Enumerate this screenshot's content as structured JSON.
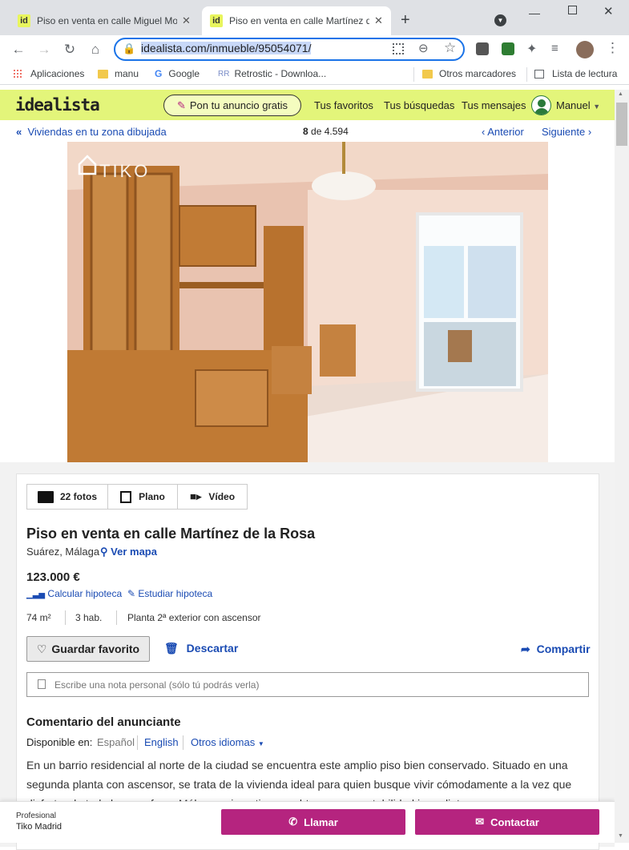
{
  "browser": {
    "tabs": [
      {
        "title": "Piso en venta en calle Miguel Mo",
        "favicon": "id"
      },
      {
        "title": "Piso en venta en calle Martínez d",
        "favicon": "id"
      }
    ],
    "url": "idealista.com/inmueble/95054071/",
    "bookmarks": [
      "Aplicaciones",
      "manu",
      "Google",
      "Retrostic - Downloa...",
      "Otros marcadores",
      "Lista de lectura"
    ]
  },
  "site": {
    "logo": "idealista",
    "ad_button": "Pon tu anuncio gratis",
    "nav": [
      "Tus favoritos",
      "Tus búsquedas",
      "Tus mensajes"
    ],
    "user": "Manuel",
    "back_link": "Viviendas en tu zona dibujada",
    "position_current": "8",
    "position_total": "de 4.594",
    "prev": "Anterior",
    "next": "Siguiente",
    "watermark": "TIKO"
  },
  "listing": {
    "media_tabs": [
      "22 fotos",
      "Plano",
      "Vídeo"
    ],
    "title": "Piso en venta en calle Martínez de la Rosa",
    "location": "Suárez, Málaga",
    "map_link": "Ver mapa",
    "price": "123.000 €",
    "mortgage_links": [
      "Calcular hipoteca",
      "Estudiar hipoteca"
    ],
    "features": [
      "74 m²",
      "3 hab.",
      "Planta 2ª exterior con ascensor"
    ],
    "favorite_button": "Guardar favorito",
    "discard": "Descartar",
    "share": "Compartir",
    "note_placeholder": "Escribe una nota personal (sólo tú podrás verla)",
    "comment_heading": "Comentario del anunciante",
    "available_in_label": "Disponible en:",
    "languages": [
      "Español",
      "English",
      "Otros idiomas"
    ],
    "description": "En un barrio residencial al norte de la ciudad se encuentra este amplio piso bien conservado. Situado en una segunda planta con ascensor, se trata de la vivienda ideal para quien busque vivir cómodamente a la vez que disfrutar de todo lo que ofrece Málaga, o invertir para obtener una rentabilidad inmediata."
  },
  "contact_bar": {
    "advertiser_type": "Profesional",
    "advertiser_name": "Tiko Madrid",
    "call": "Llamar",
    "contact": "Contactar"
  }
}
